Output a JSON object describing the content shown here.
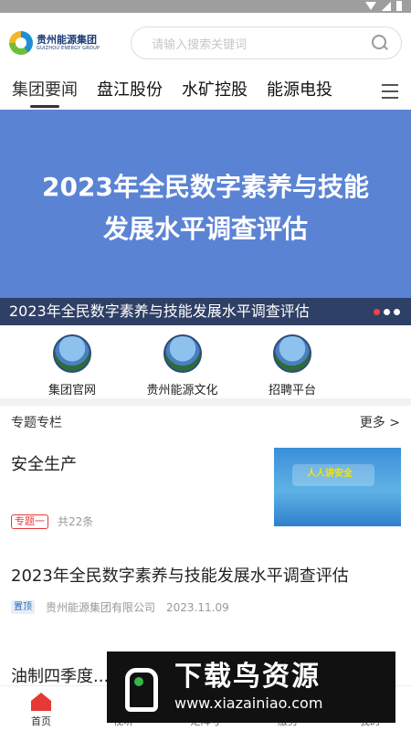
{
  "logo": {
    "name_cn": "贵州能源集团",
    "name_en": "GUIZHOU ENERGY GROUP"
  },
  "search": {
    "placeholder": "请输入搜索关键词"
  },
  "tabs": [
    {
      "label": "集团要闻",
      "active": true
    },
    {
      "label": "盘江股份"
    },
    {
      "label": "水矿控股"
    },
    {
      "label": "能源电投"
    }
  ],
  "banner": {
    "title_line1": "2023年全民数字素养与技能",
    "title_line2": "发展水平调查评估",
    "caption": "2023年全民数字素养与技能发展水平调查评估",
    "background_color": "#5b83d4"
  },
  "quick_links": [
    {
      "label": "集团官网"
    },
    {
      "label": "贵州能源文化"
    },
    {
      "label": "招聘平台"
    }
  ],
  "section": {
    "title": "专题专栏",
    "more": "更多 >"
  },
  "topic": {
    "title": "安全生产",
    "tag": "专题一",
    "count": "共22条",
    "thumb_text": "人人讲安全"
  },
  "news": [
    {
      "title": "2023年全民数字素养与技能发展水平调查评估",
      "tag": "置顶",
      "source": "贵州能源集团有限公司",
      "date": "2023.11.09"
    },
    {
      "title": "油制四季度..."
    }
  ],
  "bottom_nav": [
    {
      "label": "首页",
      "active": true
    },
    {
      "label": "视听"
    },
    {
      "label": "矩阵号"
    },
    {
      "label": "服务"
    },
    {
      "label": "我的"
    }
  ],
  "watermark": {
    "text": "下载鸟资源",
    "url": "www.xiazainiao.com"
  },
  "colors": {
    "accent_red": "#e53935",
    "banner_blue": "#5b83d4",
    "status_gray": "#9e9e9e"
  }
}
